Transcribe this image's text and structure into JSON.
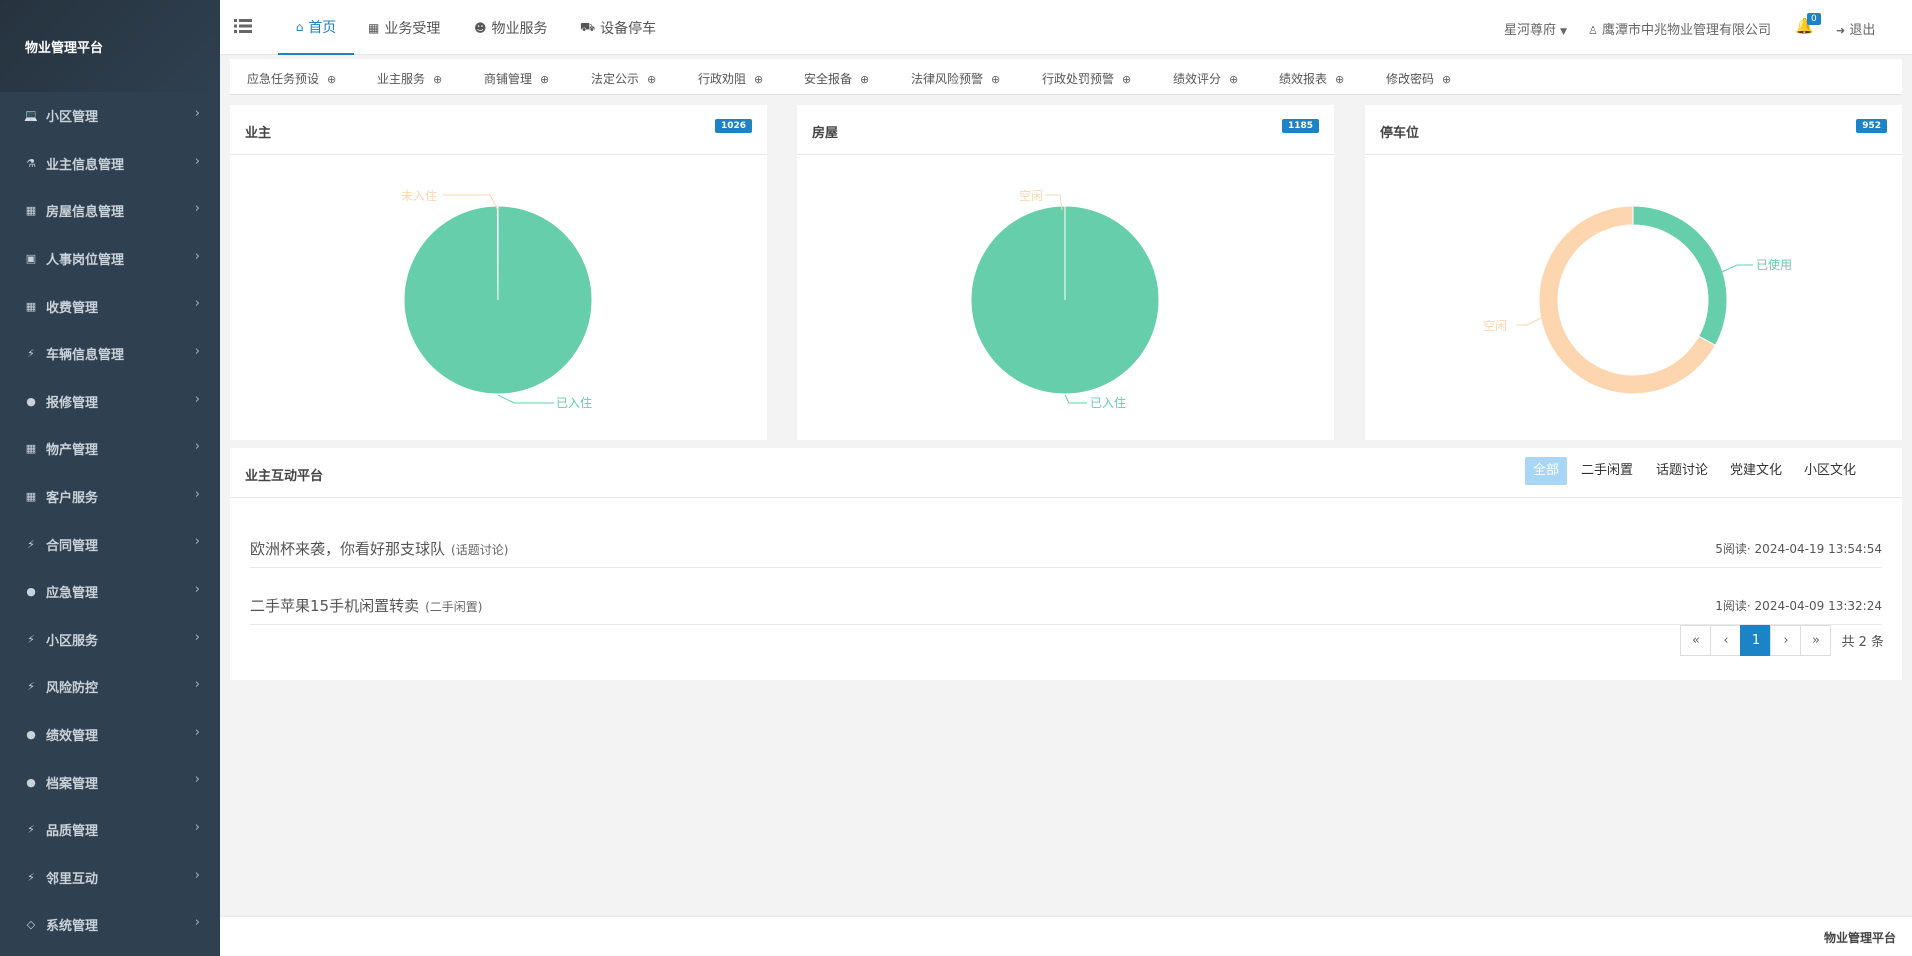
{
  "sidebar": {
    "brand": "物业管理平台",
    "items": [
      {
        "label": "小区管理",
        "icon": "laptop-icon"
      },
      {
        "label": "业主信息管理",
        "icon": "flask-icon"
      },
      {
        "label": "房屋信息管理",
        "icon": "grid-icon"
      },
      {
        "label": "人事岗位管理",
        "icon": "desktop-icon"
      },
      {
        "label": "收费管理",
        "icon": "calculator-icon"
      },
      {
        "label": "车辆信息管理",
        "icon": "bolt-icon"
      },
      {
        "label": "报修管理",
        "icon": "globe-icon"
      },
      {
        "label": "物产管理",
        "icon": "grid-icon"
      },
      {
        "label": "客户服务",
        "icon": "grid-icon"
      },
      {
        "label": "合同管理",
        "icon": "bolt-icon"
      },
      {
        "label": "应急管理",
        "icon": "globe-icon"
      },
      {
        "label": "小区服务",
        "icon": "bolt-icon"
      },
      {
        "label": "风险防控",
        "icon": "bolt-icon"
      },
      {
        "label": "绩效管理",
        "icon": "globe-icon"
      },
      {
        "label": "档案管理",
        "icon": "globe-icon"
      },
      {
        "label": "品质管理",
        "icon": "bolt-icon"
      },
      {
        "label": "邻里互动",
        "icon": "bolt-icon"
      },
      {
        "label": "系统管理",
        "icon": "diamond-icon"
      }
    ]
  },
  "topnav": {
    "tabs": [
      {
        "label": "首页",
        "icon": "home-icon"
      },
      {
        "label": "业务受理",
        "icon": "calculator-icon"
      },
      {
        "label": "物业服务",
        "icon": "users-icon"
      },
      {
        "label": "设备停车",
        "icon": "car-icon"
      }
    ],
    "community": "星河尊府",
    "company": "鹰潭市中兆物业管理有限公司",
    "notify_count": "0",
    "logout": "退出"
  },
  "quicklinks": [
    "应急任务预设",
    "业主服务",
    "商铺管理",
    "法定公示",
    "行政劝阻",
    "安全报备",
    "法律风险预警",
    "行政处罚预警",
    "绩效评分",
    "绩效报表",
    "修改密码"
  ],
  "panels": {
    "owner": {
      "title": "业主",
      "badge": "1026"
    },
    "house": {
      "title": "房屋",
      "badge": "1185"
    },
    "parking": {
      "title": "停车位",
      "badge": "952"
    }
  },
  "chart_data": [
    {
      "type": "pie",
      "categories": [
        "已入住",
        "未入住"
      ],
      "values": [
        1025,
        1
      ],
      "colors": [
        "#66ceab",
        "#fdd6b0"
      ]
    },
    {
      "type": "pie",
      "categories": [
        "已入住",
        "空闲"
      ],
      "values": [
        1185,
        0
      ],
      "colors": [
        "#66ceab",
        "#fdd6b0"
      ]
    },
    {
      "type": "pie",
      "donut": true,
      "categories": [
        "已使用",
        "空闲"
      ],
      "values": [
        33,
        67
      ],
      "colors": [
        "#66ceab",
        "#fdd6b0"
      ]
    }
  ],
  "interaction": {
    "title": "业主互动平台",
    "tabs": [
      "全部",
      "二手闲置",
      "话题讨论",
      "党建文化",
      "小区文化"
    ],
    "posts": [
      {
        "title": "欧洲杯来袭，你看好那支球队",
        "category": "(话题讨论)",
        "meta": "5阅读· 2024-04-19 13:54:54"
      },
      {
        "title": "二手苹果15手机闲置转卖",
        "category": "(二手闲置)",
        "meta": "1阅读· 2024-04-09 13:32:24"
      }
    ],
    "pager": {
      "first": "«",
      "prev": "‹",
      "current": "1",
      "next": "›",
      "last": "»",
      "total": "共 2 条"
    }
  },
  "footer": "物业管理平台",
  "colors": {
    "sidebar": "#2f4050",
    "accent": "#1c84c6",
    "pie_green": "#66ceab",
    "pie_peach": "#fdd6b0"
  }
}
